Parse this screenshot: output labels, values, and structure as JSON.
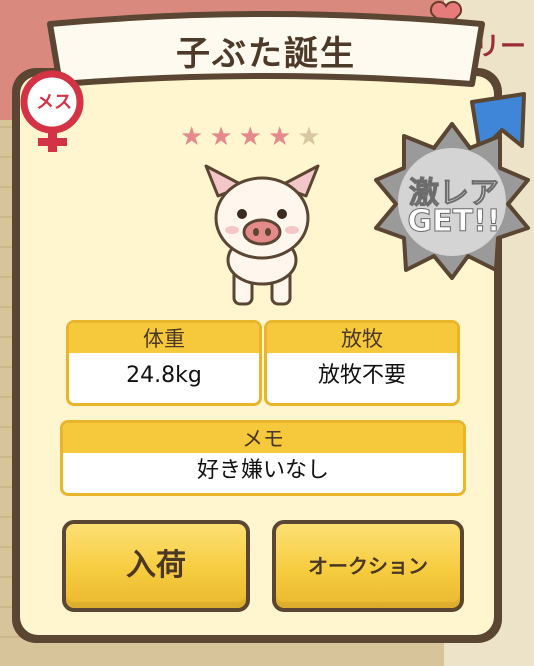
{
  "dialog": {
    "title": "子ぶた誕生",
    "gender_label": "メス",
    "rarity_badge_line1": "激レア",
    "rarity_badge_line2": "GET!!",
    "stars_filled": 4,
    "stars_total": 5
  },
  "stats": {
    "weight_label": "体重",
    "weight_value": "24.8kg",
    "grazing_label": "放牧",
    "grazing_value": "放牧不要",
    "memo_label": "メモ",
    "memo_value": "好き嫌いなし"
  },
  "buttons": {
    "stock": "入荷",
    "auction": "オークション"
  },
  "background": {
    "partial_text": "ブリー\nク"
  },
  "colors": {
    "star_filled": "#e58a8a",
    "star_empty": "#d8c7a0",
    "gender": "#d33345",
    "accent_yellow": "#f6c93c"
  }
}
